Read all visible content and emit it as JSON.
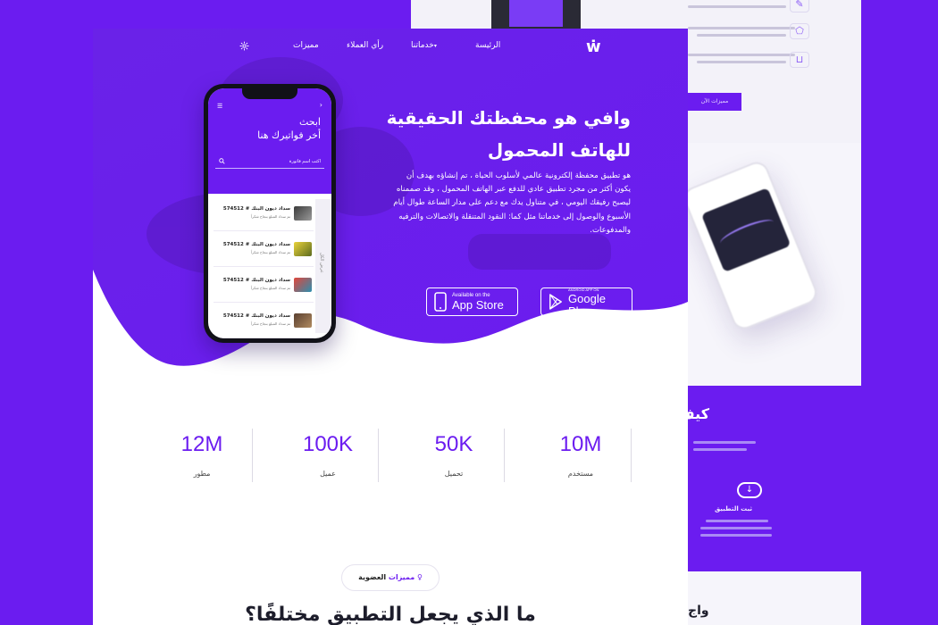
{
  "colors": {
    "brand": "#6b1cf0",
    "text_dark": "#1d1d2b",
    "white": "#ffffff"
  },
  "nav": {
    "logo": "ẇ",
    "items": [
      "الرئيسة",
      "خدماتنا",
      "رأي العملاء",
      "مميزات"
    ],
    "settings_icon": "gear-icon"
  },
  "hero": {
    "title_line1": "وافي هو محفظتك الحقيقية",
    "title_line2": "للهاتف المحمول",
    "description": "هو تطبيق محفظة إلكترونية عالمي لأسلوب الحياة ، تم إنشاؤه بهدف أن يكون أكثر من مجرد تطبيق عادي للدفع عبر الهاتف المحمول ، وقد صممناه ليصبح رفيقك اليومي ، في متناول يدك مع دعم على مدار الساعة طوال أيام الأسبوع والوصول إلى خدماتنا مثل كما: النقود المتنقلة والاتصالات والترفيه والمدفوعات.",
    "google_play": {
      "small": "ANDROID APP ON",
      "big": "Google Play"
    },
    "app_store": {
      "small": "Available on the",
      "big": "App Store"
    }
  },
  "phone": {
    "heading_line1": "ابحث",
    "heading_line2": "أخر فواتيرك هنا",
    "search_placeholder": "اكتب اسم فاتورة",
    "side_tab": "عرض الكل",
    "bills": [
      {
        "title": "سداد ديون البنك # 574512",
        "sub": "تم سداد المبلغ بنجاح شكراً"
      },
      {
        "title": "سداد ديون البنك # 574512",
        "sub": "تم سداد المبلغ بنجاح شكراً"
      },
      {
        "title": "سداد ديون البنك # 574512",
        "sub": "تم سداد المبلغ بنجاح شكراً"
      },
      {
        "title": "سداد ديون البنك # 574512",
        "sub": "تم سداد المبلغ بنجاح شكراً"
      }
    ]
  },
  "stats": [
    {
      "value": "10M",
      "label": "مستخدم"
    },
    {
      "value": "50K",
      "label": "تحميل"
    },
    {
      "value": "100K",
      "label": "عميل"
    },
    {
      "value": "12M",
      "label": "مطور"
    }
  ],
  "features": {
    "pill_accent": "مميزات",
    "pill_text": "العضوية",
    "title": "ما الذي يجعل التطبيق مختلفًا؟"
  },
  "background_mock": {
    "button_label": "مميزات الآن",
    "section_title": "كيف",
    "sub_title": "ثبت التطبيق",
    "bottom_title": "واج"
  }
}
